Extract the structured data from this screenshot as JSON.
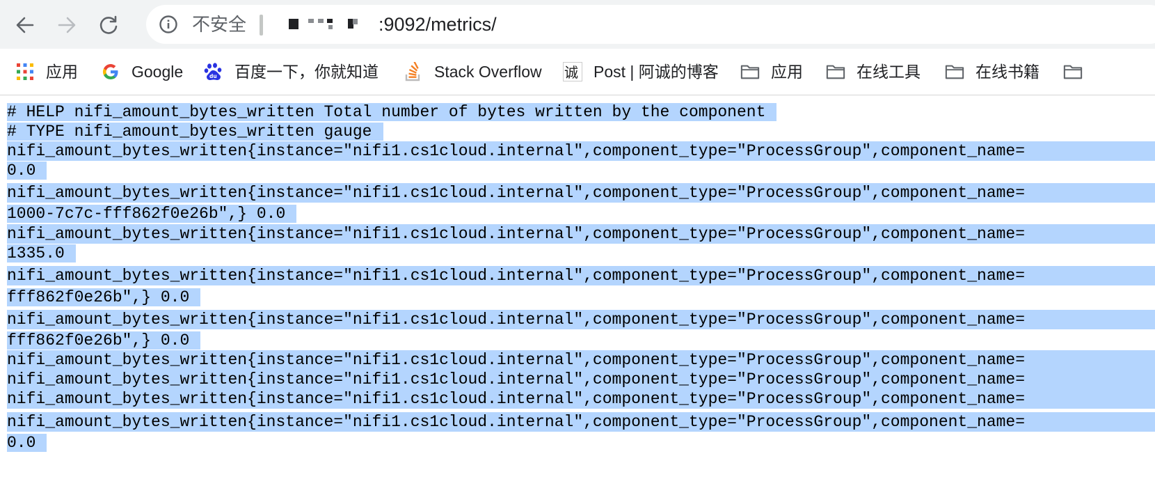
{
  "toolbar": {
    "security_label": "不安全",
    "url_suffix": ":9092/metrics/",
    "icons": [
      "back-icon",
      "forward-icon",
      "reload-icon",
      "info-icon"
    ]
  },
  "bookmarks": [
    {
      "label": "应用",
      "icon": "apps-grid-icon"
    },
    {
      "label": "Google",
      "icon": "google-logo-icon"
    },
    {
      "label": "百度一下，你就知道",
      "icon": "baidu-paw-icon"
    },
    {
      "label": "Stack Overflow",
      "icon": "stackoverflow-icon"
    },
    {
      "label": "Post | 阿诚的博客",
      "icon": "cheng-blog-icon"
    },
    {
      "label": "应用",
      "icon": "folder-icon"
    },
    {
      "label": "在线工具",
      "icon": "folder-icon"
    },
    {
      "label": "在线书籍",
      "icon": "folder-icon"
    }
  ],
  "content": {
    "lines": [
      "# HELP nifi_amount_bytes_written Total number of bytes written by the component",
      "# TYPE nifi_amount_bytes_written gauge",
      "nifi_amount_bytes_written{instance=\"nifi1.cs1cloud.internal\",component_type=\"ProcessGroup\",component_name=",
      "0.0",
      "nifi_amount_bytes_written{instance=\"nifi1.cs1cloud.internal\",component_type=\"ProcessGroup\",component_name=",
      "1000-7c7c-fff862f0e26b\",} 0.0",
      "nifi_amount_bytes_written{instance=\"nifi1.cs1cloud.internal\",component_type=\"ProcessGroup\",component_name=",
      "1335.0",
      "nifi_amount_bytes_written{instance=\"nifi1.cs1cloud.internal\",component_type=\"ProcessGroup\",component_name=",
      "fff862f0e26b\",} 0.0",
      "nifi_amount_bytes_written{instance=\"nifi1.cs1cloud.internal\",component_type=\"ProcessGroup\",component_name=",
      "fff862f0e26b\",} 0.0",
      "nifi_amount_bytes_written{instance=\"nifi1.cs1cloud.internal\",component_type=\"ProcessGroup\",component_name=",
      "nifi_amount_bytes_written{instance=\"nifi1.cs1cloud.internal\",component_type=\"ProcessGroup\",component_name=",
      "nifi_amount_bytes_written{instance=\"nifi1.cs1cloud.internal\",component_type=\"ProcessGroup\",component_name=",
      "nifi_amount_bytes_written{instance=\"nifi1.cs1cloud.internal\",component_type=\"ProcessGroup\",component_name=",
      "0.0"
    ],
    "selection_color": "#b4d5fe"
  }
}
